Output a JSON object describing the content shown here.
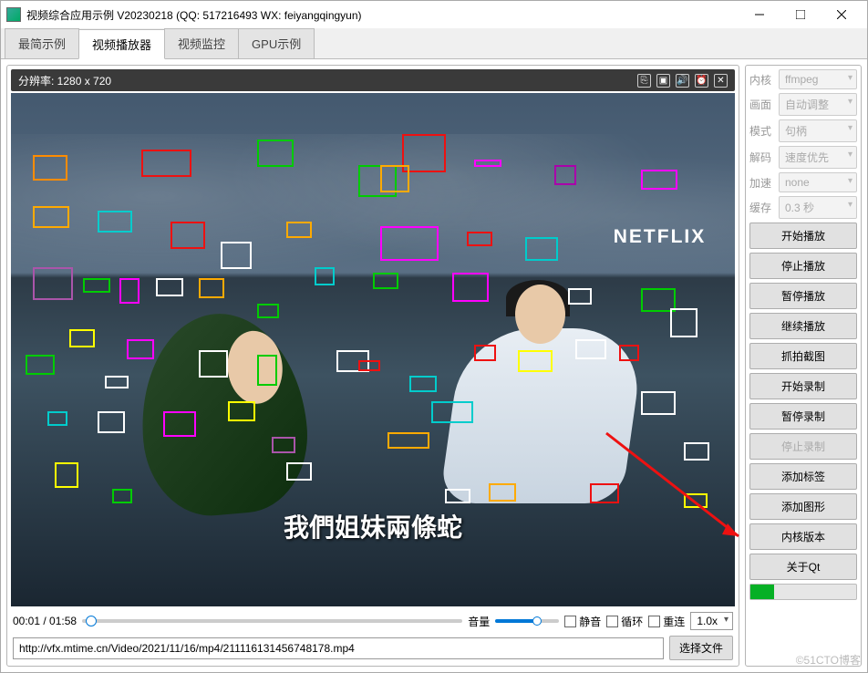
{
  "window": {
    "title": "视频综合应用示例 V20230218 (QQ: 517216493 WX: feiyangqingyun)"
  },
  "tabs": [
    {
      "label": "最简示例"
    },
    {
      "label": "视频播放器"
    },
    {
      "label": "视频监控"
    },
    {
      "label": "GPU示例"
    }
  ],
  "video": {
    "resolution_label": "分辨率: 1280 x 720",
    "netflix_logo": "NETFLIX",
    "subtitle": "我們姐妹兩條蛇"
  },
  "playback": {
    "time": "00:01 / 01:58",
    "volume_label": "音量",
    "mute_label": "静音",
    "loop_label": "循环",
    "reconnect_label": "重连",
    "speed": "1.0x",
    "url": "http://vfx.mtime.cn/Video/2021/11/16/mp4/211116131456748178.mp4",
    "choose_file_label": "选择文件"
  },
  "sidebar": {
    "props": [
      {
        "label": "内核",
        "value": "ffmpeg"
      },
      {
        "label": "画面",
        "value": "自动调整"
      },
      {
        "label": "模式",
        "value": "句柄"
      },
      {
        "label": "解码",
        "value": "速度优先"
      },
      {
        "label": "加速",
        "value": "none"
      },
      {
        "label": "缓存",
        "value": "0.3 秒"
      }
    ],
    "buttons": [
      "开始播放",
      "停止播放",
      "暂停播放",
      "继续播放",
      "抓拍截图",
      "开始录制",
      "暂停录制",
      "停止录制",
      "添加标签",
      "添加图形",
      "内核版本",
      "关于Qt"
    ],
    "disabled_index": 7
  },
  "watermark": "©51CTO博客"
}
